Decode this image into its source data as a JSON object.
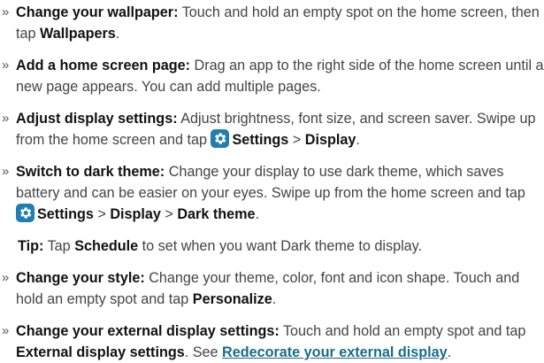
{
  "bullet_symbol": "»",
  "items": [
    {
      "title": "Change your wallpaper:",
      "text1": " Touch and hold an empty spot on the home screen, then tap ",
      "bold1": "Wallpapers",
      "text2": "."
    },
    {
      "title": "Add a home screen page:",
      "text1": " Drag an app to the right side of the home screen until a new page appears. You can add multiple pages."
    },
    {
      "title": "Adjust display settings:",
      "text1": " Adjust brightness, font size, and screen saver. Swipe up from the home screen and tap ",
      "icon": "settings-gear-icon",
      "bold1": "Settings",
      "sep1": " > ",
      "bold2": "Display",
      "text2": "."
    },
    {
      "title": "Switch to dark theme:",
      "text1": " Change your display to use dark theme, which saves battery and can be easier on your eyes. Swipe up from the home screen and tap ",
      "icon": "settings-gear-icon",
      "bold1": "Settings",
      "sep1": " > ",
      "bold2": "Display",
      "sep2": " > ",
      "bold3": "Dark theme",
      "text2": "."
    },
    {
      "title": "Change your style:",
      "text1": " Change your theme, color, font and icon shape. Touch and hold an empty spot and tap ",
      "bold1": "Personalize",
      "text2": "."
    },
    {
      "title": "Change your external display settings:",
      "text1": " Touch and hold an empty spot and tap ",
      "bold1": "External display settings",
      "text2": ". See ",
      "link": "Redecorate your external display",
      "text3": "."
    }
  ],
  "tip": {
    "label": "Tip:",
    "text1": " Tap ",
    "bold1": "Schedule",
    "text2": " to set when you want Dark theme to display."
  },
  "colors": {
    "text": "#444444",
    "bold": "#111111",
    "link": "#1a6b8a",
    "icon_bg": "#1f7fb0"
  }
}
